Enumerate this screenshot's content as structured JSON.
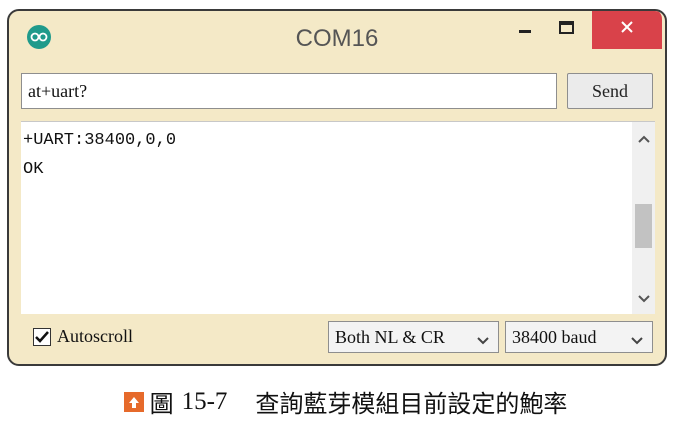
{
  "window": {
    "title": "COM16",
    "app_icon": "arduino-infinity-icon",
    "minimize_icon": "minimize-icon",
    "maximize_icon": "maximize-icon",
    "close_icon": "close-icon",
    "close_button_color": "#d9424a"
  },
  "command": {
    "value": "at+uart?",
    "send_label": "Send"
  },
  "output": {
    "lines": [
      "+UART:38400,0,0",
      "OK"
    ]
  },
  "footer": {
    "autoscroll_label": "Autoscroll",
    "autoscroll_checked": true,
    "line_ending_selected": "Both NL & CR",
    "baud_selected": "38400 baud"
  },
  "caption": {
    "label": "圖",
    "number": "15-7",
    "text": "查詢藍芽模組目前設定的鮑率"
  }
}
